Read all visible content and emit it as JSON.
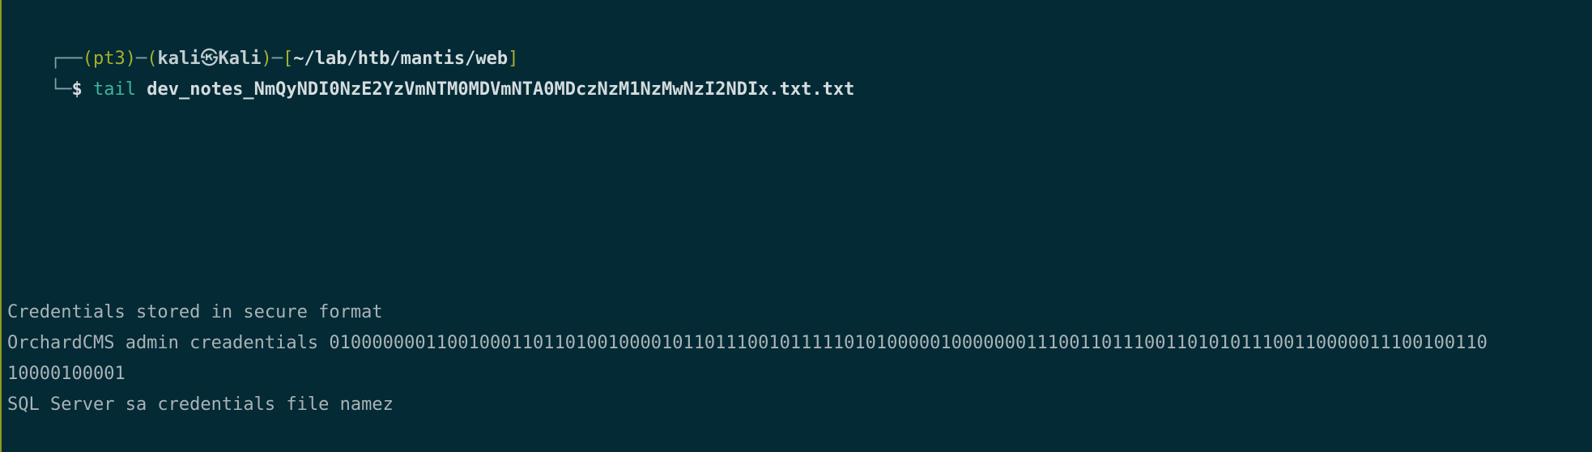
{
  "window": {
    "background": "#032a35",
    "accent": "#a7b02b",
    "command_color": "#3fb59f"
  },
  "prompt": {
    "frame_top": "┌──",
    "env": "pt3",
    "user": "kali",
    "at_symbol": "㉿",
    "host": "Kali",
    "cwd": "~/lab/htb/mantis/web",
    "frame_bottom": "└─",
    "dollar": "$"
  },
  "command": {
    "name": "tail",
    "argument": "dev_notes_NmQyNDI0NzE2YzVmNTM0MDVmNTA0MDczNzM1NzMwNzI2NDIx.txt.txt"
  },
  "output": [
    "Credentials stored in secure format",
    "OrchardCMS admin creadentials 010000000110010001101101001000010110111001011111010100000100000001110011011100110101011100110000011100100110",
    "10000100001",
    "SQL Server sa credentials file namez"
  ]
}
